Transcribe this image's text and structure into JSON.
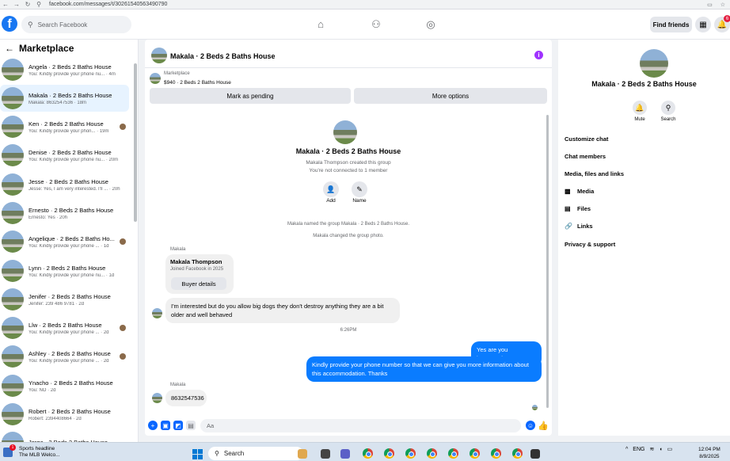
{
  "browser": {
    "url": "facebook.com/messages/t/30261540563490790"
  },
  "topbar": {
    "search_placeholder": "Search Facebook",
    "find_friends": "Find friends",
    "notif_count": "6"
  },
  "sidebar": {
    "title": "Marketplace",
    "conversations": [
      {
        "name": "Angela · 2 Beds 2 Baths House",
        "preview": "You: Kindly provide your phone nu... · 4m",
        "dot": false
      },
      {
        "name": "Makala · 2 Beds 2 Baths House",
        "preview": "Makala: 8632547536 · 18m",
        "dot": false,
        "active": true
      },
      {
        "name": "Ken · 2 Beds 2 Baths House",
        "preview": "You: Kindly provide your phon... · 19m",
        "dot": true
      },
      {
        "name": "Denise · 2 Beds 2 Baths House",
        "preview": "You: Kindly provide your phone nu... · 20m",
        "dot": false
      },
      {
        "name": "Jesse · 2 Beds 2 Baths House",
        "preview": "Jesse: Yes, I am very interested. I'll ... · 20h",
        "dot": false
      },
      {
        "name": "Ernesto · 2 Beds 2 Baths House",
        "preview": "Ernesto: Yes · 20h",
        "dot": false
      },
      {
        "name": "Angelique · 2 Beds 2 Baths Ho...",
        "preview": "You: Kindly provide your phone ... · 1d",
        "dot": true
      },
      {
        "name": "Lynn · 2 Beds 2 Baths House",
        "preview": "You: Kindly provide your phone nu... · 1d",
        "dot": false
      },
      {
        "name": "Jenifer · 2 Beds 2 Baths House",
        "preview": "Jenifer: 239 486 9781 · 2d",
        "dot": false
      },
      {
        "name": "Llw · 2 Beds 2 Baths House",
        "preview": "You: Kindly provide your phone ... · 2d",
        "dot": true
      },
      {
        "name": "Ashley · 2 Beds 2 Baths House",
        "preview": "You: Kindly provide your phone ... · 2d",
        "dot": true
      },
      {
        "name": "Ynacho · 2 Beds 2 Baths House",
        "preview": "You: NO · 2d",
        "dot": false
      },
      {
        "name": "Robert · 2 Beds 2 Baths House",
        "preview": "Robert: 2394408664 · 2d",
        "dot": false
      },
      {
        "name": "Jorge · 2 Beds 2 Baths House",
        "preview": "",
        "dot": false
      }
    ]
  },
  "chat": {
    "title": "Makala · 2 Beds 2 Baths House",
    "marketplace_label": "Marketplace",
    "listing": "$940 · 2 Beds 2 Baths House",
    "mark_pending": "Mark as pending",
    "more_options": "More options",
    "group_name": "Makala · 2 Beds 2 Baths House",
    "created": "Makala Thompson created this group",
    "not_connected": "You're not connected to 1 member",
    "add_label": "Add",
    "name_label": "Name",
    "sys1": "Makala named the group Makala · 2 Beds 2 Baths House.",
    "sys2": "Makala changed the group photo.",
    "sender1": "Makala",
    "card_name": "Makala Thompson",
    "card_sub": "Joined Facebook in 2025",
    "buyer_details": "Buyer details",
    "msg_in1": "I'm interested but do you allow big dogs they don't destroy anything they are a bit older and well behaved",
    "time1": "6:26PM",
    "msg_out1": "Yes are you interested?",
    "msg_out2": "Kindly provide your phone number so that we can give you more information about this accommodation. Thanks",
    "sender2": "Makala",
    "msg_in2": "8632547536",
    "composer_placeholder": "Aa"
  },
  "rpanel": {
    "name": "Makala · 2 Beds 2 Baths House",
    "mute": "Mute",
    "search": "Search",
    "items": [
      "Customize chat",
      "Chat members",
      "Media, files and links",
      "Media",
      "Files",
      "Links",
      "Privacy & support"
    ]
  },
  "taskbar": {
    "news_title": "Sports headline",
    "news_sub": "The MLB Welco...",
    "news_badge": "1",
    "search": "Search",
    "lang": "ENG",
    "time": "12:04 PM",
    "date": "8/9/2025"
  }
}
